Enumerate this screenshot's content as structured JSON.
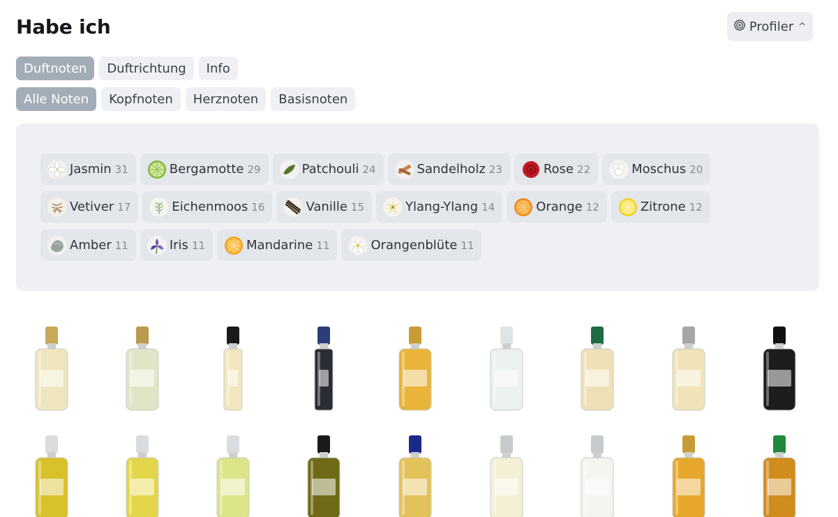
{
  "header": {
    "title": "Habe ich",
    "profiler_label": "Profiler",
    "profiler_chevron": "^"
  },
  "tabs_primary": [
    {
      "label": "Duftnoten",
      "active": true
    },
    {
      "label": "Duftrichtung",
      "active": false
    },
    {
      "label": "Info",
      "active": false
    }
  ],
  "tabs_secondary": [
    {
      "label": "Alle Noten",
      "active": true
    },
    {
      "label": "Kopfnoten",
      "active": false
    },
    {
      "label": "Herznoten",
      "active": false
    },
    {
      "label": "Basisnoten",
      "active": false
    }
  ],
  "notes": [
    {
      "name": "Jasmin",
      "count": "31",
      "icon": "jasmine-flower-icon"
    },
    {
      "name": "Bergamotte",
      "count": "29",
      "icon": "bergamot-slice-icon"
    },
    {
      "name": "Patchouli",
      "count": "24",
      "icon": "patchouli-leaf-icon"
    },
    {
      "name": "Sandelholz",
      "count": "23",
      "icon": "sandalwood-icon"
    },
    {
      "name": "Rose",
      "count": "22",
      "icon": "rose-icon"
    },
    {
      "name": "Moschus",
      "count": "20",
      "icon": "musk-icon"
    },
    {
      "name": "Vetiver",
      "count": "17",
      "icon": "vetiver-root-icon"
    },
    {
      "name": "Eichenmoos",
      "count": "16",
      "icon": "oakmoss-icon"
    },
    {
      "name": "Vanille",
      "count": "15",
      "icon": "vanilla-pod-icon"
    },
    {
      "name": "Ylang-Ylang",
      "count": "14",
      "icon": "ylang-ylang-flower-icon"
    },
    {
      "name": "Orange",
      "count": "12",
      "icon": "orange-slice-icon"
    },
    {
      "name": "Zitrone",
      "count": "12",
      "icon": "lemon-slice-icon"
    },
    {
      "name": "Amber",
      "count": "11",
      "icon": "amber-stone-icon"
    },
    {
      "name": "Iris",
      "count": "11",
      "icon": "iris-flower-icon"
    },
    {
      "name": "Mandarine",
      "count": "11",
      "icon": "mandarin-slice-icon"
    },
    {
      "name": "Orangenblüte",
      "count": "11",
      "icon": "orange-blossom-icon"
    }
  ],
  "bottles_row1": [
    {
      "icon": "perfume-bottle-icon",
      "liquid": "#efe6bf",
      "cap": "#c9a85a"
    },
    {
      "icon": "perfume-bottle-icon",
      "liquid": "#dfe6c6",
      "cap": "#b99a4e"
    },
    {
      "icon": "perfume-bottle-icon",
      "liquid": "#f1e6bd",
      "cap": "#1a1a1a"
    },
    {
      "icon": "perfume-bottle-icon",
      "liquid": "#2a2d33",
      "cap": "#2b3e7a"
    },
    {
      "icon": "perfume-bottle-icon",
      "liquid": "#e8b43a",
      "cap": "#c99b34"
    },
    {
      "icon": "perfume-bottle-icon",
      "liquid": "#eaf1ee",
      "cap": "#dfe4e6"
    },
    {
      "icon": "perfume-bottle-icon",
      "liquid": "#efe1b6",
      "cap": "#1f6b45"
    },
    {
      "icon": "perfume-bottle-icon",
      "liquid": "#f0e3b8",
      "cap": "#a6a6a6"
    },
    {
      "icon": "perfume-bottle-icon",
      "liquid": "#1c1c1c",
      "cap": "#111111"
    }
  ],
  "bottles_row2": [
    {
      "icon": "perfume-bottle-icon",
      "liquid": "#d8c12a",
      "cap": "#d9dde0"
    },
    {
      "icon": "perfume-bottle-icon",
      "liquid": "#e4d64a",
      "cap": "#d9dde0"
    },
    {
      "icon": "perfume-bottle-icon",
      "liquid": "#dce48a",
      "cap": "#d9dde0"
    },
    {
      "icon": "perfume-bottle-icon",
      "liquid": "#6f6a18",
      "cap": "#1a1a1a"
    },
    {
      "icon": "perfume-bottle-icon",
      "liquid": "#e4c25a",
      "cap": "#1b2a8a"
    },
    {
      "icon": "perfume-bottle-icon",
      "liquid": "#f3f0d6",
      "cap": "#c8cbce"
    },
    {
      "icon": "perfume-bottle-icon",
      "liquid": "#f4f4f0",
      "cap": "#c8cbce"
    },
    {
      "icon": "perfume-bottle-icon",
      "liquid": "#e7a72c",
      "cap": "#c79b36"
    },
    {
      "icon": "perfume-bottle-icon",
      "liquid": "#d08c1c",
      "cap": "#1f8a3a"
    }
  ]
}
